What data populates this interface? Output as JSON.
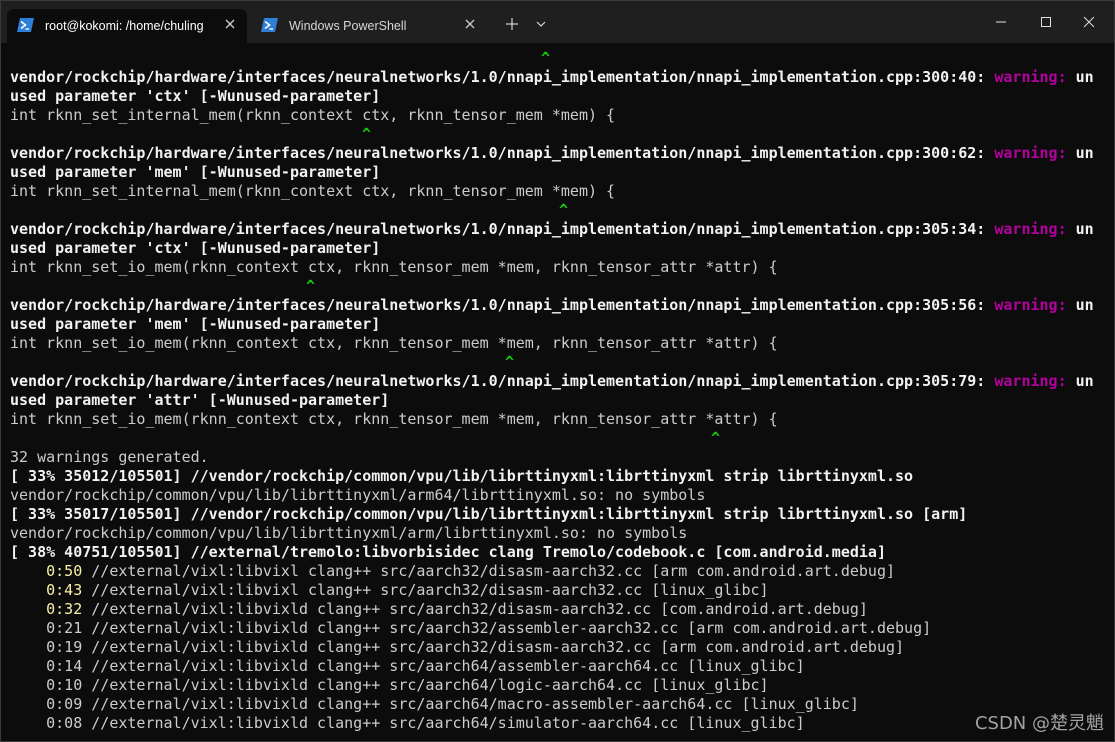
{
  "tabs": [
    {
      "title": "root@kokomi: /home/chuling",
      "active": true,
      "icon": "powershell-icon"
    },
    {
      "title": "Windows PowerShell",
      "active": false,
      "icon": "powershell-icon"
    }
  ],
  "titlebar": {
    "new_tab_icon": "plus-icon",
    "dropdown_icon": "chevron-down-icon",
    "window_controls": [
      "minimize-icon",
      "maximize-icon",
      "close-icon"
    ]
  },
  "colors": {
    "background": "#0c0c0c",
    "warning": "#b4009e",
    "caret": "#16c60c",
    "timer_highlight": "#f9f1a5"
  },
  "terminal": {
    "caret": "^",
    "warning_label": "warning:",
    "caret_lines": [
      {
        "col": 75
      },
      {
        "col": 50
      },
      {
        "col": 77
      },
      {
        "col": 41
      },
      {
        "col": 69
      },
      {
        "col": 98
      }
    ],
    "warnings": [
      {
        "path": "vendor/rockchip/hardware/interfaces/neuralnetworks/1.0/nnapi_implementation/nnapi_implementation.cpp:300:40:",
        "wrap_head": "un",
        "wrap_tail": "used parameter 'ctx' [-Wunused-parameter]",
        "source": "int rknn_set_internal_mem(rknn_context ctx, rknn_tensor_mem *mem) {"
      },
      {
        "path": "vendor/rockchip/hardware/interfaces/neuralnetworks/1.0/nnapi_implementation/nnapi_implementation.cpp:300:62:",
        "wrap_head": "un",
        "wrap_tail": "used parameter 'mem' [-Wunused-parameter]",
        "source": "int rknn_set_internal_mem(rknn_context ctx, rknn_tensor_mem *mem) {"
      },
      {
        "path": "vendor/rockchip/hardware/interfaces/neuralnetworks/1.0/nnapi_implementation/nnapi_implementation.cpp:305:34:",
        "wrap_head": "un",
        "wrap_tail": "used parameter 'ctx' [-Wunused-parameter]",
        "source": "int rknn_set_io_mem(rknn_context ctx, rknn_tensor_mem *mem, rknn_tensor_attr *attr) {"
      },
      {
        "path": "vendor/rockchip/hardware/interfaces/neuralnetworks/1.0/nnapi_implementation/nnapi_implementation.cpp:305:56:",
        "wrap_head": "un",
        "wrap_tail": "used parameter 'mem' [-Wunused-parameter]",
        "source": "int rknn_set_io_mem(rknn_context ctx, rknn_tensor_mem *mem, rknn_tensor_attr *attr) {"
      },
      {
        "path": "vendor/rockchip/hardware/interfaces/neuralnetworks/1.0/nnapi_implementation/nnapi_implementation.cpp:305:79:",
        "wrap_head": "un",
        "wrap_tail": "used parameter 'attr' [-Wunused-parameter]",
        "source": "int rknn_set_io_mem(rknn_context ctx, rknn_tensor_mem *mem, rknn_tensor_attr *attr) {"
      }
    ],
    "summary": "32 warnings generated.",
    "build_lines": [
      {
        "text": "[ 33% 35012/105501] //vendor/rockchip/common/vpu/lib/librttinyxml:librttinyxml strip librttinyxml.so",
        "bold": true
      },
      {
        "text": "vendor/rockchip/common/vpu/lib/librttinyxml/arm64/librttinyxml.so: no symbols",
        "bold": false
      },
      {
        "text": "[ 33% 35017/105501] //vendor/rockchip/common/vpu/lib/librttinyxml:librttinyxml strip librttinyxml.so [arm]",
        "bold": true
      },
      {
        "text": "vendor/rockchip/common/vpu/lib/librttinyxml/arm/librttinyxml.so: no symbols",
        "bold": false
      },
      {
        "text": "[ 38% 40751/105501] //external/tremolo:libvorbisidec clang Tremolo/codebook.c [com.android.media]",
        "bold": true
      }
    ],
    "jobs": [
      {
        "time": "0:50",
        "desc": "//external/vixl:libvixl clang++ src/aarch32/disasm-aarch32.cc [arm com.android.art.debug]",
        "highlight": true
      },
      {
        "time": "0:43",
        "desc": "//external/vixl:libvixl clang++ src/aarch32/disasm-aarch32.cc [linux_glibc]",
        "highlight": true
      },
      {
        "time": "0:32",
        "desc": "//external/vixl:libvixld clang++ src/aarch32/disasm-aarch32.cc [com.android.art.debug]",
        "highlight": true
      },
      {
        "time": "0:21",
        "desc": "//external/vixl:libvixld clang++ src/aarch32/assembler-aarch32.cc [arm com.android.art.debug]",
        "highlight": false
      },
      {
        "time": "0:19",
        "desc": "//external/vixl:libvixld clang++ src/aarch32/disasm-aarch32.cc [arm com.android.art.debug]",
        "highlight": false
      },
      {
        "time": "0:14",
        "desc": "//external/vixl:libvixld clang++ src/aarch64/assembler-aarch64.cc [linux_glibc]",
        "highlight": false
      },
      {
        "time": "0:10",
        "desc": "//external/vixl:libvixld clang++ src/aarch64/logic-aarch64.cc [linux_glibc]",
        "highlight": false
      },
      {
        "time": "0:09",
        "desc": "//external/vixl:libvixld clang++ src/aarch64/macro-assembler-aarch64.cc [linux_glibc]",
        "highlight": false
      },
      {
        "time": "0:08",
        "desc": "//external/vixl:libvixld clang++ src/aarch64/simulator-aarch64.cc [linux_glibc]",
        "highlight": false
      }
    ]
  },
  "watermark": "CSDN @楚灵魈"
}
